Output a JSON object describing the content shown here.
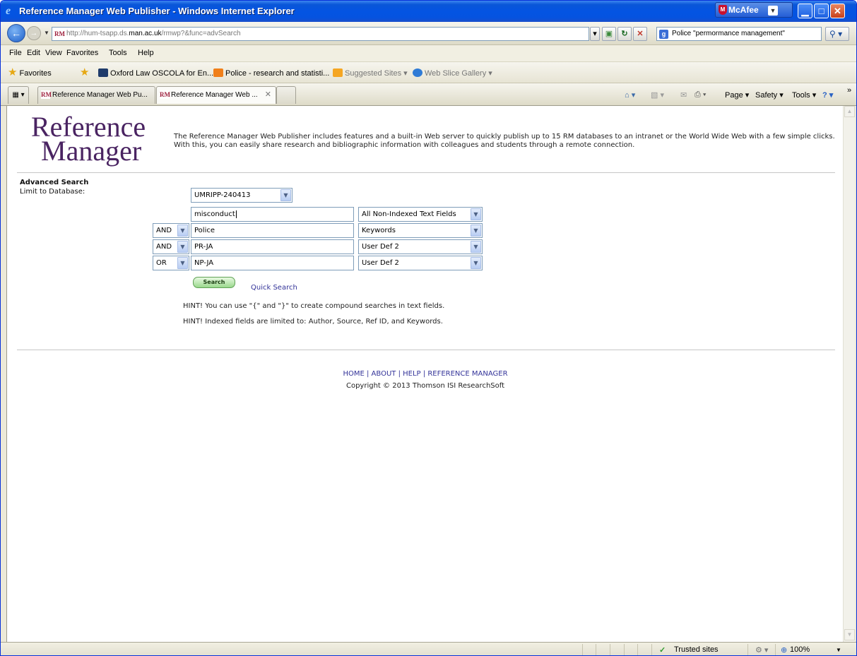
{
  "window": {
    "title": "Reference Manager Web Publisher - Windows Internet Explorer",
    "mcafee_label": "McAfee"
  },
  "address_bar": {
    "url_prefix": "http://hum-tsapp.ds.",
    "url_domain": "man.ac.uk",
    "url_suffix": "/rmwp?&func=advSearch",
    "search_query": "Police \"permormance management\""
  },
  "menu": [
    "File",
    "Edit",
    "View",
    "Favorites",
    "Tools",
    "Help"
  ],
  "favorites_bar": {
    "favorites_label": "Favorites",
    "items": [
      "Oxford Law OSCOLA for En...",
      "Police - research and statisti...",
      "Suggested Sites",
      "Web Slice Gallery"
    ]
  },
  "tabs": [
    {
      "label": "Reference Manager Web Pu...",
      "active": false
    },
    {
      "label": "Reference Manager Web ...",
      "active": true
    }
  ],
  "command_bar": [
    "Page",
    "Safety",
    "Tools"
  ],
  "page": {
    "logo_line1": "Reference",
    "logo_line2": "Manager",
    "intro": "The Reference Manager Web Publisher includes features and a built-in Web server to quickly publish up to 15 RM databases to an intranet or the World Wide Web with a few simple clicks. With this, you can easily share research and bibliographic information with colleagues and students through a remote connection.",
    "advanced_search_title": "Advanced Search",
    "limit_label": "Limit to Database:",
    "database": "UMRIPP-240413",
    "rows": [
      {
        "operator": "",
        "term": "misconduct",
        "field": "All Non-Indexed Text Fields"
      },
      {
        "operator": "AND",
        "term": "Police",
        "field": "Keywords"
      },
      {
        "operator": "AND",
        "term": "PR-JA",
        "field": "User Def 2"
      },
      {
        "operator": "OR",
        "term": "NP-JA",
        "field": "User Def 2"
      }
    ],
    "search_button": "Search",
    "quick_search": "Quick Search",
    "hint1": "HINT! You can use \"{\" and \"}\" to create compound searches in text fields.",
    "hint2": "HINT! Indexed fields are limited to: Author, Source, Ref ID, and Keywords.",
    "footer_links": [
      "HOME",
      "ABOUT",
      "HELP",
      "REFERENCE MANAGER"
    ],
    "copyright": "Copyright © 2013 Thomson ISI ResearchSoft"
  },
  "status_bar": {
    "zone": "Trusted sites",
    "zoom": "100%"
  }
}
